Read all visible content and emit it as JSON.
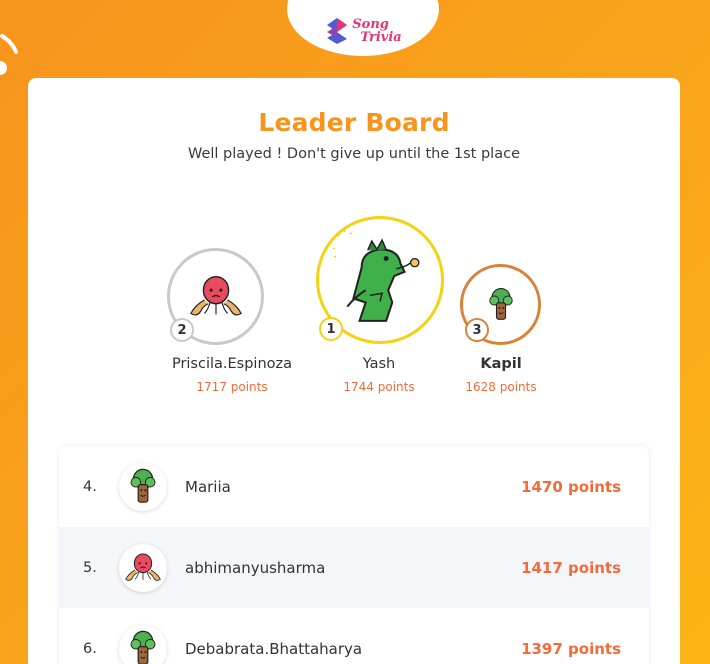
{
  "header": {
    "logo_line1": "Song",
    "logo_line2": "Trivia"
  },
  "board": {
    "title": "Leader Board",
    "subtitle": "Well played ! Don't give up until the 1st place"
  },
  "podium": [
    {
      "rank": "2",
      "name": "Priscila.Espinoza",
      "points": "1717 points",
      "avatar": "octopus-icon",
      "ring_color": "#c9c9c9"
    },
    {
      "rank": "1",
      "name": "Yash",
      "points": "1744 points",
      "avatar": "dinosaur-icon",
      "ring_color": "#f5d20f"
    },
    {
      "rank": "3",
      "name": "Kapil",
      "points": "1628 points",
      "avatar": "tree-icon",
      "ring_color": "#d7843a"
    }
  ],
  "list": [
    {
      "rank": "4.",
      "name": "Mariia",
      "points": "1470 points",
      "avatar": "tree-icon"
    },
    {
      "rank": "5.",
      "name": "abhimanyusharma",
      "points": "1417 points",
      "avatar": "octopus-icon"
    },
    {
      "rank": "6.",
      "name": "Debabrata.Bhattaharya",
      "points": "1397 points",
      "avatar": "tree-icon"
    }
  ],
  "colors": {
    "accent": "#f7941d",
    "points": "#f26b3a",
    "gold": "#f5d20f",
    "silver": "#c9c9c9",
    "bronze": "#d7843a"
  }
}
